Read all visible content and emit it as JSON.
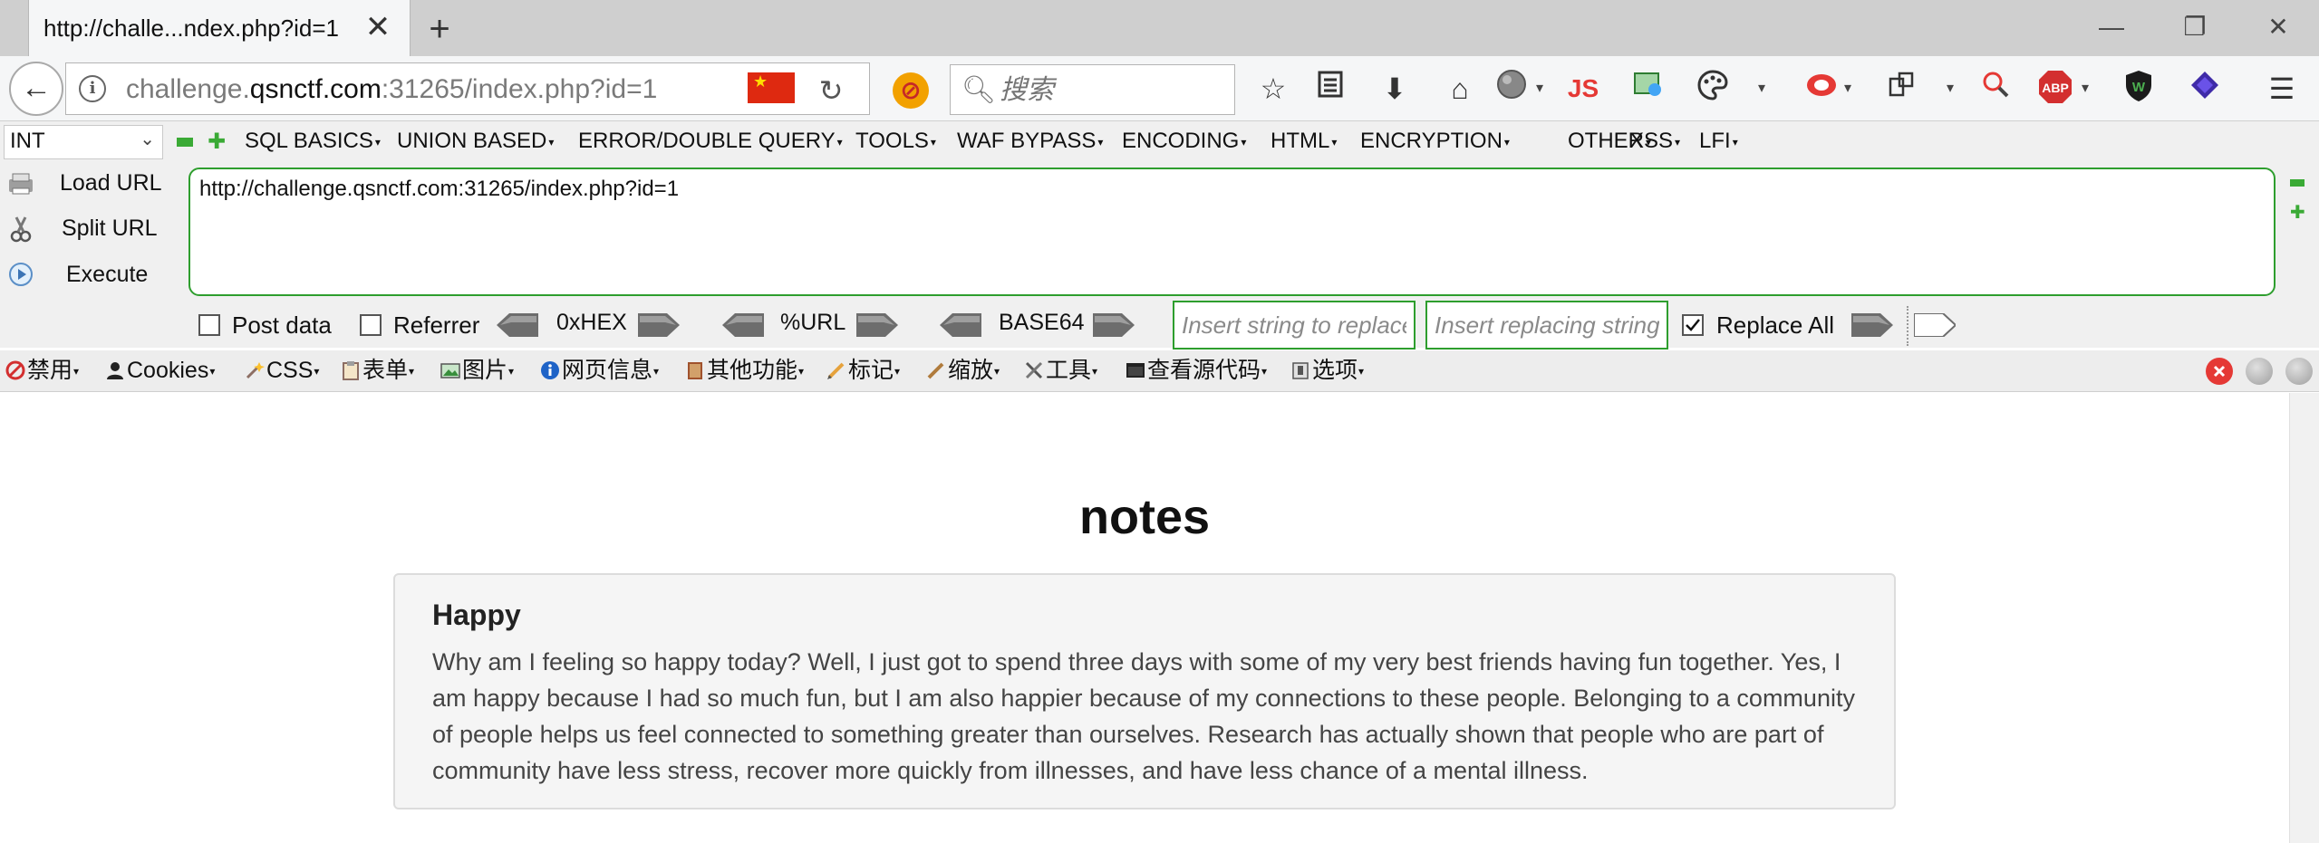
{
  "tab": {
    "title": "http://challe...ndex.php?id=1",
    "close": "✕",
    "new_tab": "+"
  },
  "window": {
    "minimize": "—",
    "restore": "❐",
    "close": "✕"
  },
  "nav": {
    "url_prefix": "challenge.",
    "url_domain": "qsnctf.com",
    "url_rest": ":31265/index.php?id=1",
    "search_placeholder": "搜索",
    "js_label": "JS",
    "abp_label": "ABP",
    "w_label": "W"
  },
  "hackbar": {
    "type_select": "INT",
    "menus": [
      "SQL BASICS",
      "UNION BASED",
      "ERROR/DOUBLE QUERY",
      "TOOLS",
      "WAF BYPASS",
      "ENCODING",
      "HTML",
      "ENCRYPTION",
      "OTHER",
      "XSS",
      "LFI"
    ],
    "load_url": "Load URL",
    "split_url": "Split URL",
    "execute": "Execute",
    "url_value": "http://challenge.qsnctf.com:31265/index.php?id=1",
    "post_data": "Post data",
    "referrer": "Referrer",
    "hex": "0xHEX",
    "url_enc": "%URL",
    "base64": "BASE64",
    "replace_from_placeholder": "Insert string to replace",
    "replace_to_placeholder": "Insert replacing string",
    "replace_all": "Replace All"
  },
  "devbar": {
    "items": [
      "禁用",
      "Cookies",
      "CSS",
      "表单",
      "图片",
      "网页信息",
      "其他功能",
      "标记",
      "缩放",
      "工具",
      "查看源代码",
      "选项"
    ]
  },
  "page": {
    "title": "notes",
    "note_title": "Happy",
    "note_body": "Why am I feeling so happy today? Well, I just got to spend three days with some of my very best friends having fun together. Yes, I am happy because I had so much fun, but I am also happier because of my connections to these people. Belonging to a community of people helps us feel connected to something greater than ourselves. Research has actually shown that people who are part of community have less stress, recover more quickly from illnesses, and have less chance of a mental illness."
  },
  "colors": {
    "accent_green": "#2e9e2e",
    "flag_red": "#de2910"
  }
}
